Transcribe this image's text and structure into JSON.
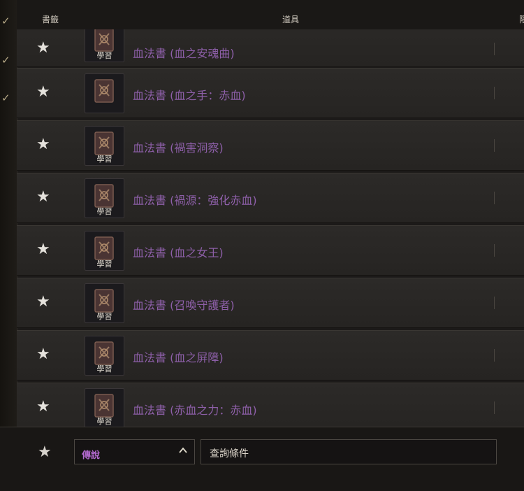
{
  "header": {
    "bookmark_label": "書籤",
    "item_label": "道具",
    "cutoff_label": "限"
  },
  "rows": [
    {
      "name": "血法書 (血之安魂曲)",
      "badge": "學習"
    },
    {
      "name": "血法書 (血之手：赤血)",
      "badge": ""
    },
    {
      "name": "血法書 (禍害洞察)",
      "badge": "學習"
    },
    {
      "name": "血法書 (禍源：強化赤血)",
      "badge": "學習"
    },
    {
      "name": "血法書 (血之女王)",
      "badge": "學習"
    },
    {
      "name": "血法書 (召喚守護者)",
      "badge": "學習"
    },
    {
      "name": "血法書 (血之屏障)",
      "badge": "學習"
    },
    {
      "name": "血法書 (赤血之力：赤血)",
      "badge": "學習"
    }
  ],
  "footer": {
    "grade_selected": "傳說",
    "search_text": "查詢條件"
  },
  "icons": {
    "star": "★",
    "check": "check-icon",
    "chevron": "chevron-up-icon",
    "book": "blood-book-icon"
  },
  "colors": {
    "item_name": "#8d5fa8",
    "grade_text": "#b46ad0",
    "gold_check": "#b8ab88"
  }
}
